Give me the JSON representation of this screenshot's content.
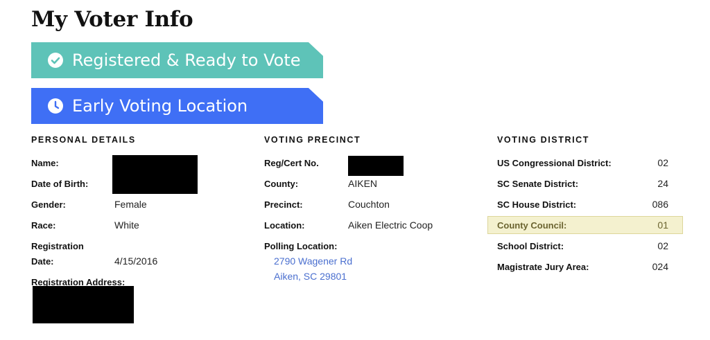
{
  "page": {
    "title": "My Voter Info"
  },
  "banners": {
    "registered": {
      "label": "Registered & Ready to Vote",
      "icon": "check-circle-icon",
      "color": "#5ec3b8"
    },
    "early_voting": {
      "label": "Early Voting Location",
      "icon": "clock-icon",
      "color": "#3f6ff5"
    }
  },
  "personal": {
    "heading": "PERSONAL DETAILS",
    "name_label": "Name:",
    "dob_label": "Date of Birth:",
    "gender_label": "Gender:",
    "gender": "Female",
    "race_label": "Race:",
    "race": "White",
    "registration_label_line1": "Registration",
    "registration_label_line2": "Date:",
    "registration_date": "4/15/2016",
    "address_label": "Registration Address:"
  },
  "precinct": {
    "heading": "VOTING PRECINCT",
    "reg_label": "Reg/Cert No.",
    "county_label": "County:",
    "county": "AIKEN",
    "precinct_label": "Precinct:",
    "precinct": "Couchton",
    "location_label": "Location:",
    "location": "Aiken Electric Coop",
    "polling_label": "Polling Location:",
    "polling_line1": "2790 Wagener Rd",
    "polling_line2": "Aiken, SC 29801"
  },
  "district": {
    "heading": "VOTING DISTRICT",
    "rows": [
      {
        "label": "US Congressional District:",
        "value": "02"
      },
      {
        "label": "SC Senate District:",
        "value": "24"
      },
      {
        "label": "SC House District:",
        "value": "086"
      },
      {
        "label": "County Council:",
        "value": "01"
      },
      {
        "label": "School District:",
        "value": "02"
      },
      {
        "label": "Magistrate Jury Area:",
        "value": "024"
      }
    ],
    "highlight_color": "#f4f1cf"
  }
}
